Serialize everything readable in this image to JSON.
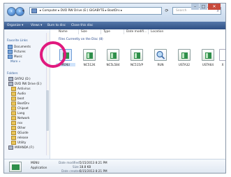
{
  "address_bar": {
    "path": "▸ Computer ▸ DVD RW Drive (E:) GIGABYTE ▸ BootDrv ▸"
  },
  "search": {
    "placeholder": "Search"
  },
  "toolbar": {
    "items": [
      "Organize ▾",
      "Views ▾",
      "Burn to disc",
      "Close this disc"
    ]
  },
  "columns": [
    "Name",
    "Size",
    "Type",
    "Date modifi...",
    "Location"
  ],
  "group_label": "Files Currently on the Disc (8)",
  "files": [
    {
      "name": "MENU",
      "icon": "app-icon",
      "selected": true
    },
    {
      "name": "NC512K",
      "icon": "app-icon"
    },
    {
      "name": "NC5L584",
      "icon": "app-icon"
    },
    {
      "name": "NC515/P",
      "icon": "app-icon"
    },
    {
      "name": "RUN",
      "icon": "magnifier-icon"
    },
    {
      "name": "USTA32",
      "icon": "app-icon"
    },
    {
      "name": "USTA64",
      "icon": "app-icon"
    },
    {
      "name": "X",
      "icon": "file-icon"
    }
  ],
  "nav": {
    "favorite_links_heading": "Favorite Links",
    "favorite_links": [
      "Documents",
      "Pictures",
      "Music",
      "More »"
    ],
    "folders_heading": "Folders",
    "tree": [
      "DATA2 (D:)",
      "DVD RW Drive (E:)",
      "Antivirus",
      "Audio",
      "boot",
      "BootDrv",
      "Chipset",
      "Lang",
      "Network",
      "nsv",
      "Other",
      "QGuide",
      "release",
      "Utility",
      "MIRANDA (F:)"
    ]
  },
  "details": {
    "name": "MENU",
    "type": "Application",
    "date_modified_label": "Date modified:",
    "date_modified": "5/15/2013 8:21 PM",
    "size_label": "Size:",
    "size": "18.8 KB",
    "date_created_label": "Date created:",
    "date_created": "5/15/2013 8:21 PM"
  },
  "colors": {
    "toolbar": "#2e4f84",
    "highlight": "#e0197e"
  }
}
